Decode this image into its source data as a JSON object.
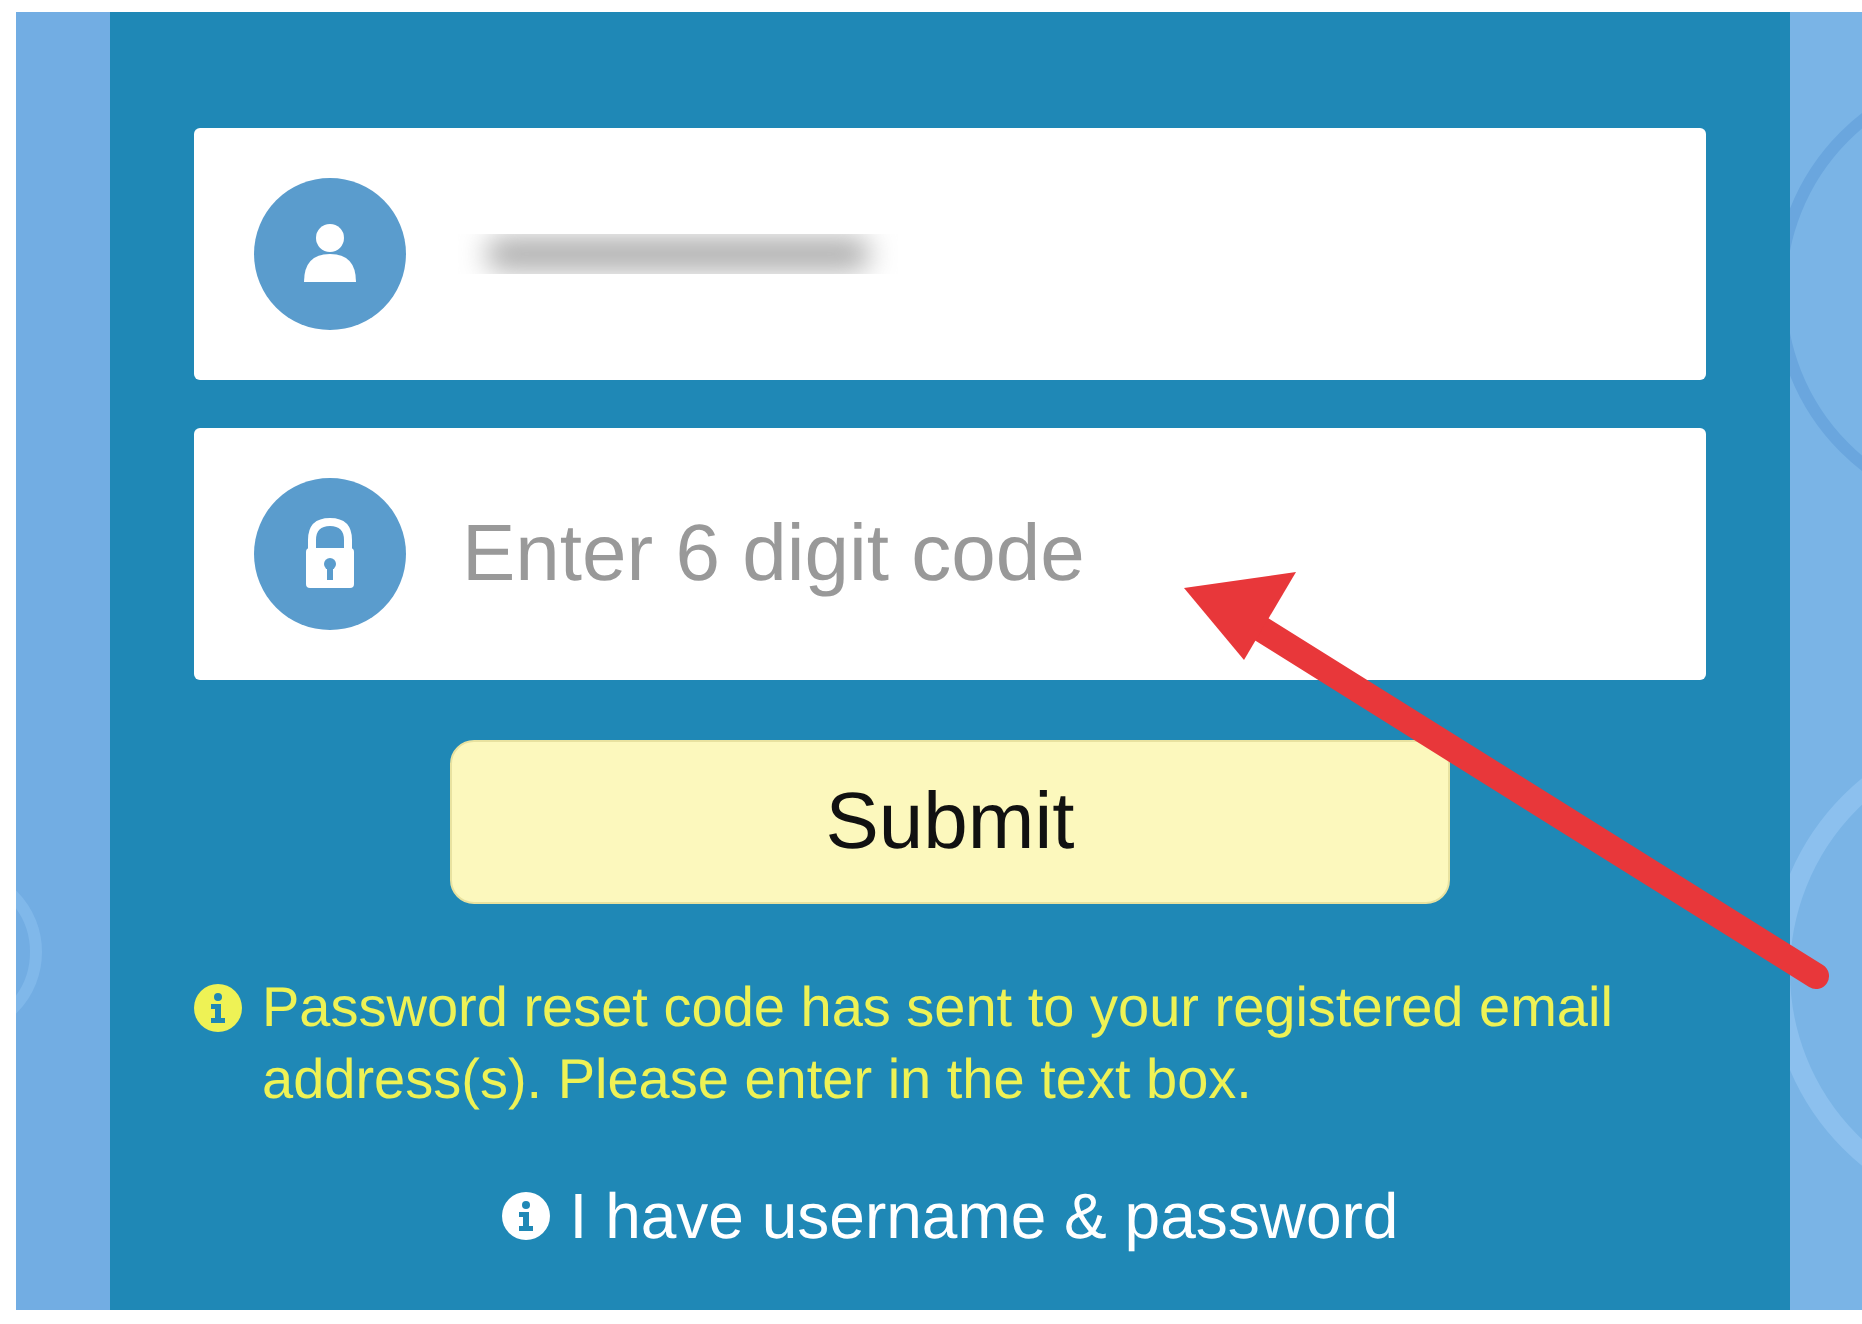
{
  "username_field": {
    "redacted": true
  },
  "code_field": {
    "placeholder": "Enter 6 digit code"
  },
  "submit_button": {
    "label": "Submit"
  },
  "info_message": {
    "text": "Password reset code has sent to your registered email address(s). Please enter in the text box."
  },
  "alt_link": {
    "label": "I have username & password"
  }
}
